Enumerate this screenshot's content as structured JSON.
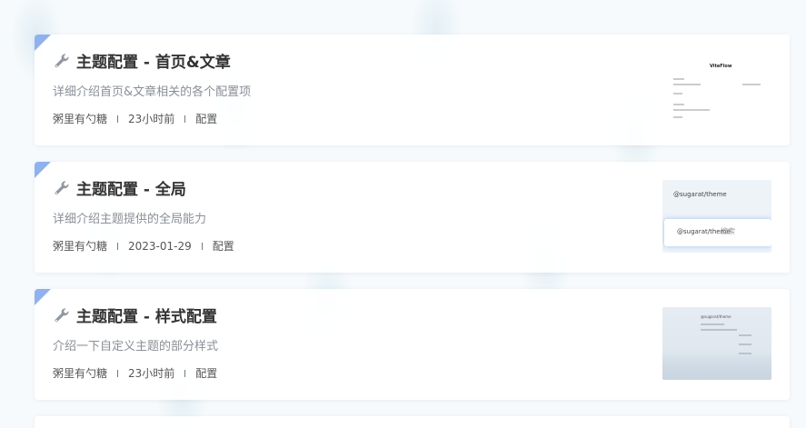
{
  "posts": [
    {
      "title": "主题配置 - 首页&文章",
      "description": "详细介绍首页&文章相关的各个配置项",
      "author": "粥里有勺糖",
      "time": "23小时前",
      "tag": "配置",
      "thumb": {
        "brand": "ViteFlow"
      }
    },
    {
      "title": "主题配置 - 全局",
      "description": "详细介绍主题提供的全局能力",
      "author": "粥里有勺糖",
      "time": "2023-01-29",
      "tag": "配置",
      "thumb": {
        "tag1": "@sugarat/theme",
        "tag2": "@sugarat/theme",
        "search": "搜索"
      }
    },
    {
      "title": "主题配置 - 样式配置",
      "description": "介绍一下自定义主题的部分样式",
      "author": "粥里有勺糖",
      "time": "23小时前",
      "tag": "配置",
      "thumb": {
        "brand": "@sugarat/theme"
      }
    }
  ],
  "icons": {
    "title_icon": "wrench-icon"
  },
  "colors": {
    "corner": "#8fb2ef",
    "title": "#333333",
    "desc": "#8a8f96"
  }
}
